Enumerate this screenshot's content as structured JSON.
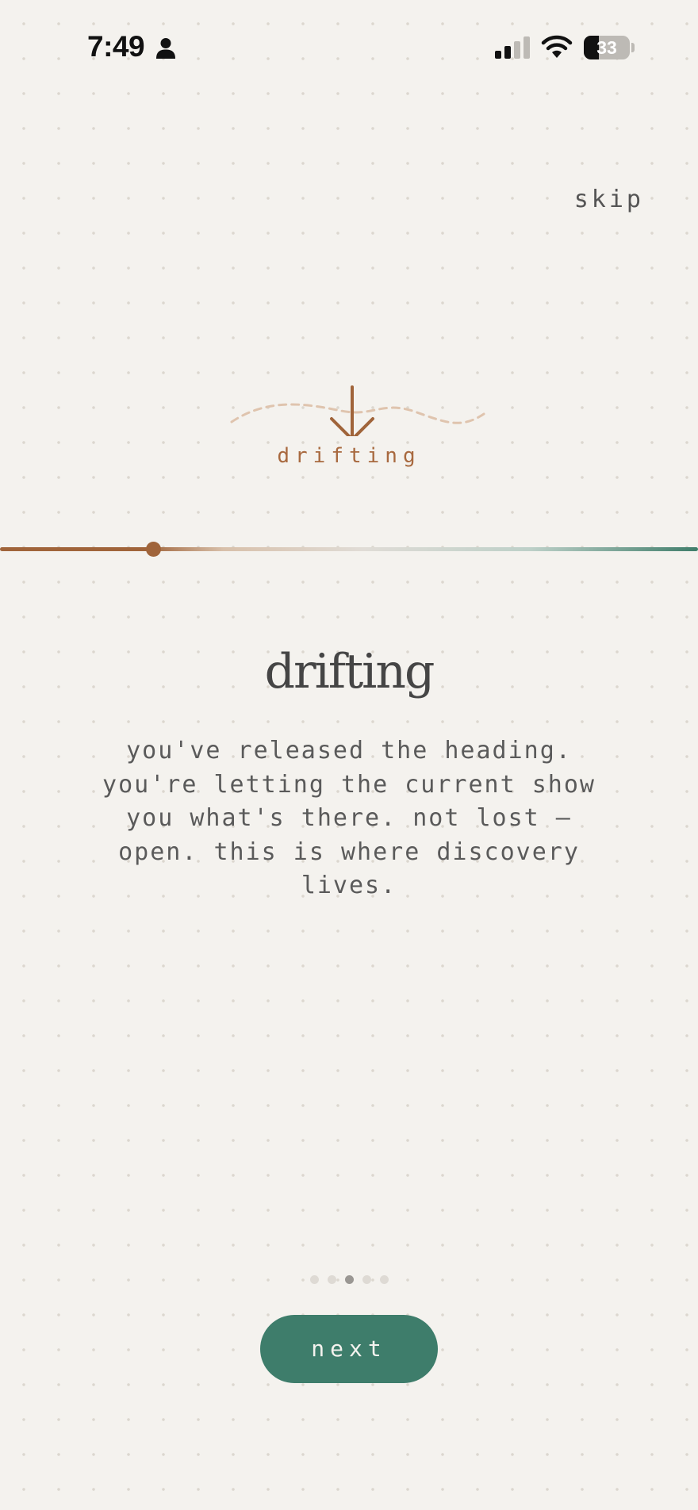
{
  "status_bar": {
    "time": "7:49",
    "battery_level": 33,
    "battery_label": "33",
    "icons": [
      "person-icon",
      "cellular-signal-icon",
      "wifi-icon",
      "battery-icon"
    ]
  },
  "skip_label": "skip",
  "illustration": {
    "icon": "arrow-down-icon",
    "label": "drifting"
  },
  "slider": {
    "value_percent": 22
  },
  "content": {
    "title": "drifting",
    "description": "you've released the heading. you're letting the current show you what's there. not lost — open. this is where discovery lives."
  },
  "pager": {
    "total": 5,
    "current": 3
  },
  "next_label": "next",
  "colors": {
    "background": "#f4f2ee",
    "accent_brown": "#a0643a",
    "accent_green": "#3e7d6b",
    "text": "#454545"
  }
}
